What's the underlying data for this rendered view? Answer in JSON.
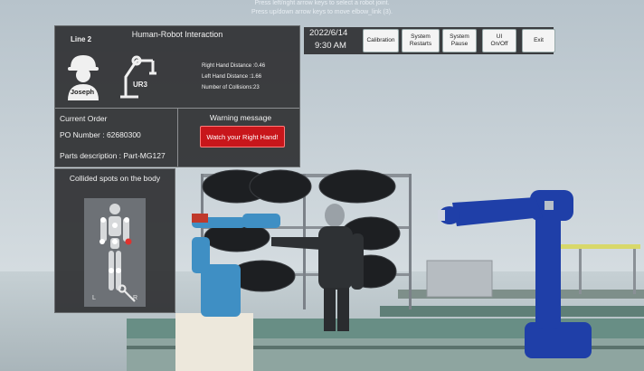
{
  "hints": {
    "line1": "Press left/right arrow keys to select a robot joint.",
    "line2": "Press up/down arrow keys to move elbow_link (3)."
  },
  "hri_panel": {
    "title": "Human-Robot Interaction",
    "line_label": "Line 2",
    "worker_name": "Joseph",
    "robot_name": "UR3",
    "right_hand_distance": "Right Hand Distance :0.46",
    "left_hand_distance": "Left Hand Distance :1.66",
    "collisions": "Number of Collisions:23",
    "current_order_label": "Current Order",
    "po_number": "PO Number : 62680300",
    "parts_description": "Parts description : Part-MG127",
    "warning_heading": "Warning message",
    "warning_button": "Watch your Right Hand!"
  },
  "collision_panel": {
    "title": "Collided spots on the body",
    "left_label": "L",
    "right_label": "R",
    "collided_spot_color": "#e0332f"
  },
  "datetime": {
    "date": "2022/6/14",
    "time": "9:30 AM"
  },
  "toolbar": {
    "calibration": "Calibration",
    "system_restarts": "System\nRestarts",
    "system_pause": "System\nPause",
    "ui_toggle": "UI\nOn/Off",
    "exit": "Exit"
  },
  "icons": {
    "worker": "worker-helmet-icon",
    "robot": "robot-arm-icon",
    "wrench": "wrench-icon"
  },
  "colors": {
    "panel_bg": "#323436",
    "warning_red": "#c8161b",
    "robot_blue": "#1f3fa8",
    "robot_cyan": "#3f8fc4"
  }
}
